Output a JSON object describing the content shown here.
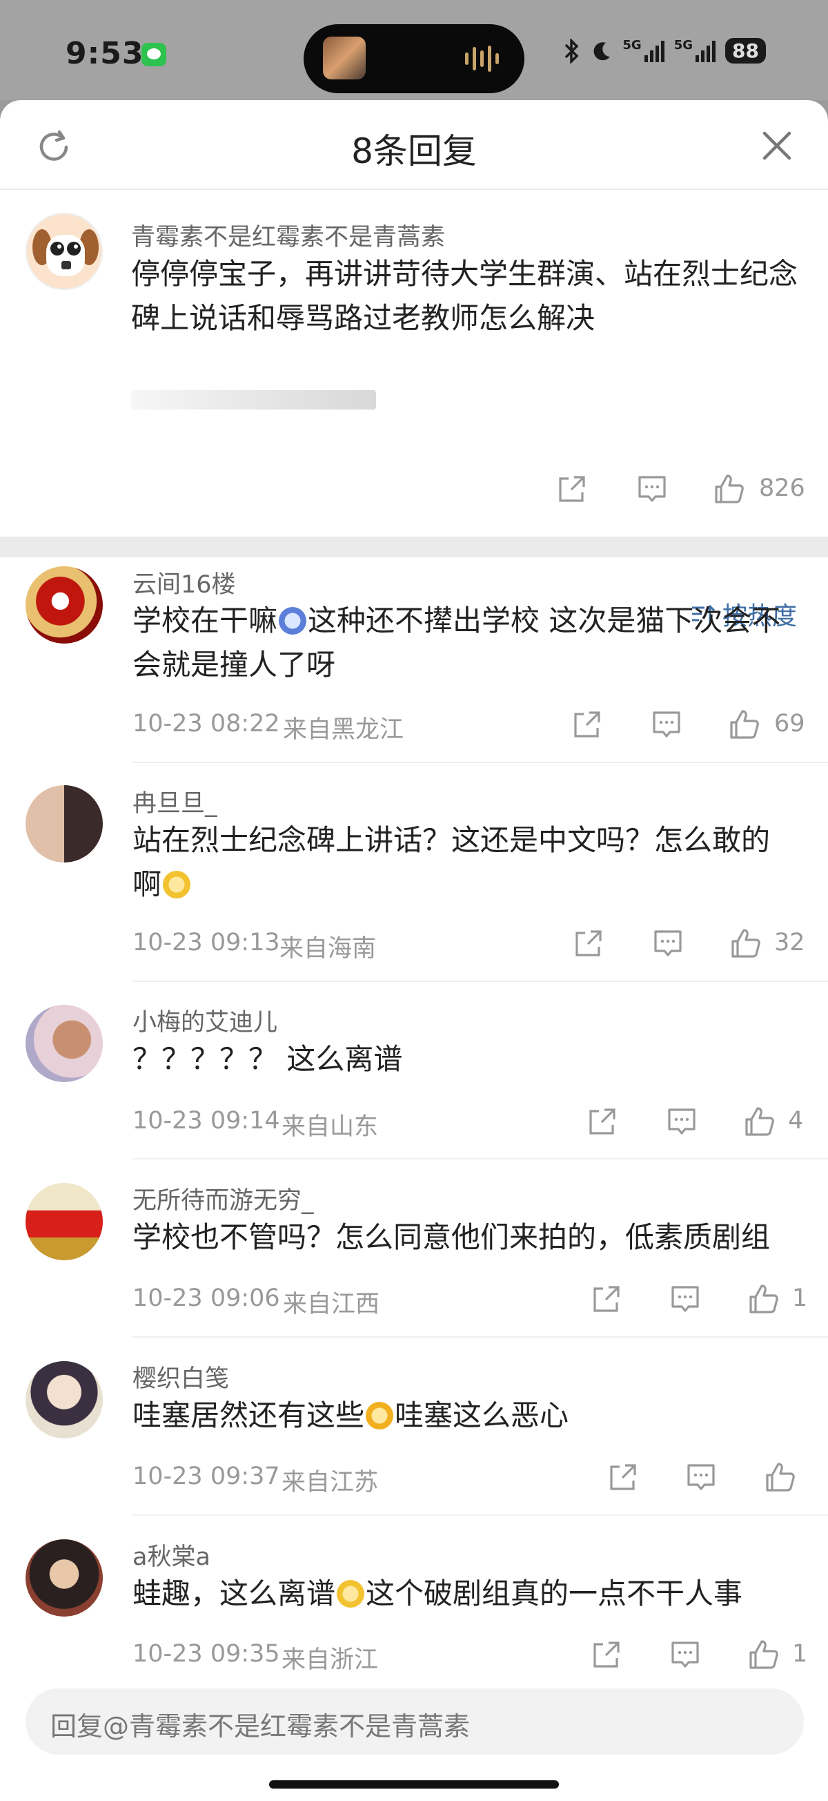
{
  "status_bar": {
    "time": "9:53",
    "network_a": "5G",
    "network_b": "5G",
    "battery": "88"
  },
  "header": {
    "title": "8条回复"
  },
  "original": {
    "name": "青霉素不是红霉素不是青蒿素",
    "text": "停停停宝子，再讲讲苛待大学生群演、站在烈士纪念碑上说话和辱骂路过老教师怎么解决",
    "likes": "826"
  },
  "sort_label": "按热度",
  "replies": [
    {
      "name": "云间16楼",
      "text_a": "学校在干嘛",
      "text_b": "这种还不撵出学校 这次是猫下次会不会就是撞人了呀",
      "time": "10-23 08:22",
      "loc": "来自黑龙江",
      "likes": "69"
    },
    {
      "name": "冉旦旦_",
      "text_a": "站在烈士纪念碑上讲话？这还是中文吗？怎么敢的啊",
      "text_b": "",
      "time": "10-23 09:13",
      "loc": "来自海南",
      "likes": "32"
    },
    {
      "name": "小梅的艾迪儿",
      "text_a": "？？？？？ 这么离谱",
      "text_b": "",
      "time": "10-23 09:14",
      "loc": "来自山东",
      "likes": "4"
    },
    {
      "name": "无所待而游无穷_",
      "text_a": "学校也不管吗？怎么同意他们来拍的，低素质剧组",
      "text_b": "",
      "time": "10-23 09:06",
      "loc": "来自江西",
      "likes": "1"
    },
    {
      "name": "樱织白笺",
      "text_a": "哇塞居然还有这些",
      "text_b": "哇塞这么恶心",
      "time": "10-23 09:37",
      "loc": "来自江苏",
      "likes": ""
    },
    {
      "name": "a秋棠a",
      "text_a": "蛙趣，这么离谱",
      "text_b": "这个破剧组真的一点不干人事",
      "time": "10-23 09:35",
      "loc": "来自浙江",
      "likes": "1"
    }
  ],
  "reply_input": {
    "placeholder": "回复@青霉素不是红霉素不是青蒿素"
  }
}
